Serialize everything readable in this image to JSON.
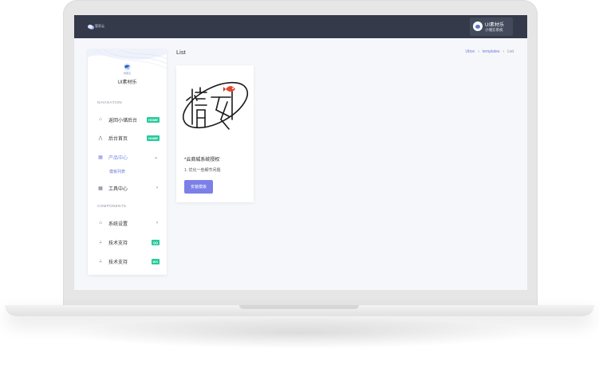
{
  "topbar": {
    "logo_text": "管家云",
    "user_name": "UI素材乐",
    "user_sub": "小储云系统"
  },
  "sidebar": {
    "logo_text": "管家云",
    "brand": "UI素材乐",
    "sections": {
      "navigation": "NAVIGATION",
      "components": "COMPONENTS"
    },
    "items": [
      {
        "label": "返回小储后台",
        "badge": "HOME"
      },
      {
        "label": "后台首页",
        "badge": "HOME"
      },
      {
        "label": "产品中心",
        "chevron": "⌄"
      },
      {
        "label": "工具中心",
        "chevron": "›"
      },
      {
        "label": "系统设置",
        "chevron": "›"
      },
      {
        "label": "技术支持",
        "badge": "QQ"
      },
      {
        "label": "技术支持",
        "badge": "WX"
      }
    ],
    "sub_item": "模板列表"
  },
  "main": {
    "title": "List",
    "breadcrumb": [
      "Ubox",
      "templates",
      "List"
    ],
    "card": {
      "title": "*云商城系统授权",
      "desc": "1. 优化一些细节问题",
      "button": "安装模板"
    }
  },
  "colors": {
    "topbar": "#343a4a",
    "accent": "#7c7fe8",
    "badge": "#27c99a"
  }
}
